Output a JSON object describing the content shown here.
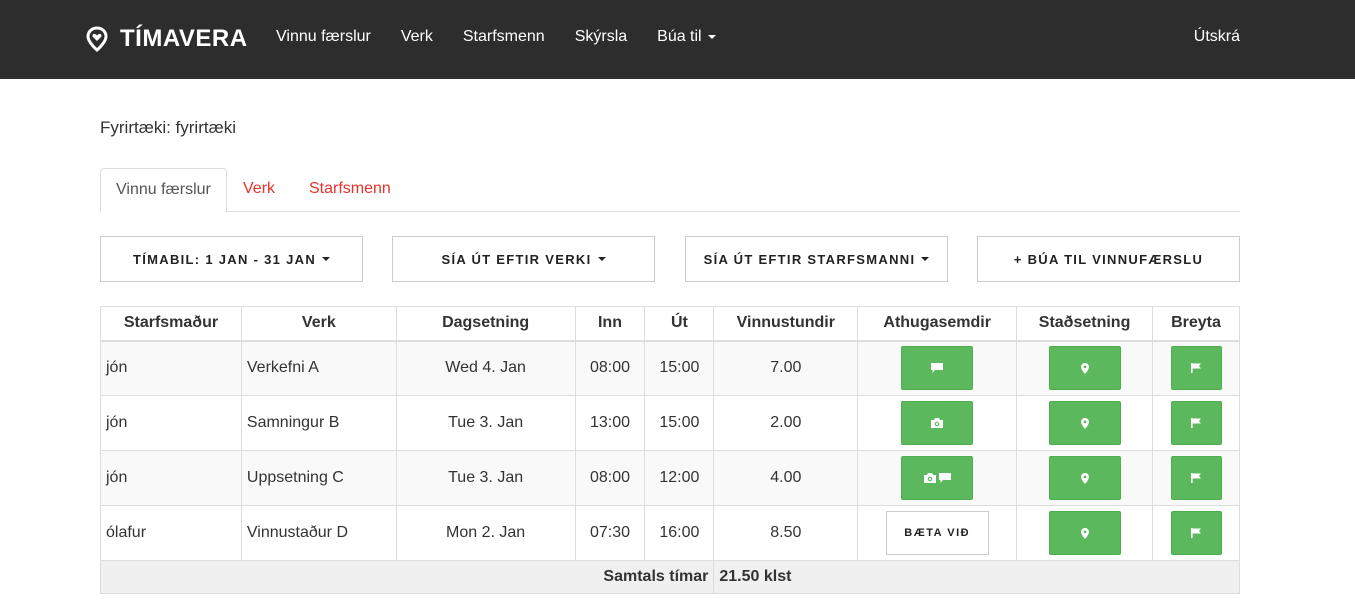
{
  "navbar": {
    "brand": "TÍMAVERA",
    "links": [
      "Vinnu færslur",
      "Verk",
      "Starfsmenn",
      "Skýrsla",
      "Búa til"
    ],
    "logout": "Útskrá"
  },
  "company": "Fyrirtæki: fyrirtæki",
  "tabs": [
    "Vinnu færslur",
    "Verk",
    "Starfsmenn"
  ],
  "filters": {
    "period": "TÍMABIL: 1 JAN - 31 JAN",
    "by_project": "SÍA ÚT EFTIR VERKI",
    "by_employee": "SÍA ÚT EFTIR STARFSMANNI",
    "create": "+ BÚA TIL VINNUFÆRSLU"
  },
  "table": {
    "headers": [
      "Starfsmaður",
      "Verk",
      "Dagsetning",
      "Inn",
      "Út",
      "Vinnustundir",
      "Athugasemdir",
      "Staðsetning",
      "Breyta"
    ],
    "rows": [
      {
        "employee": "jón",
        "project": "Verkefni A",
        "date": "Wed 4. Jan",
        "in": "08:00",
        "out": "15:00",
        "hours": "7.00",
        "comments": [
          "comment-icon"
        ]
      },
      {
        "employee": "jón",
        "project": "Samningur B",
        "date": "Tue 3. Jan",
        "in": "13:00",
        "out": "15:00",
        "hours": "2.00",
        "comments": [
          "camera-icon"
        ]
      },
      {
        "employee": "jón",
        "project": "Uppsetning C",
        "date": "Tue 3. Jan",
        "in": "08:00",
        "out": "12:00",
        "hours": "4.00",
        "comments": [
          "camera-icon",
          "comment-icon"
        ]
      },
      {
        "employee": "ólafur",
        "project": "Vinnustaður D",
        "date": "Mon 2. Jan",
        "in": "07:30",
        "out": "16:00",
        "hours": "8.50",
        "comments": []
      }
    ],
    "add_comment_label": "BÆTA VIÐ",
    "total_label": "Samtals tímar",
    "total_value": "21.50 klst"
  },
  "colors": {
    "navbar": "#2d2d2d",
    "accent_red": "#e8322b",
    "button_green": "#5cb85c"
  }
}
